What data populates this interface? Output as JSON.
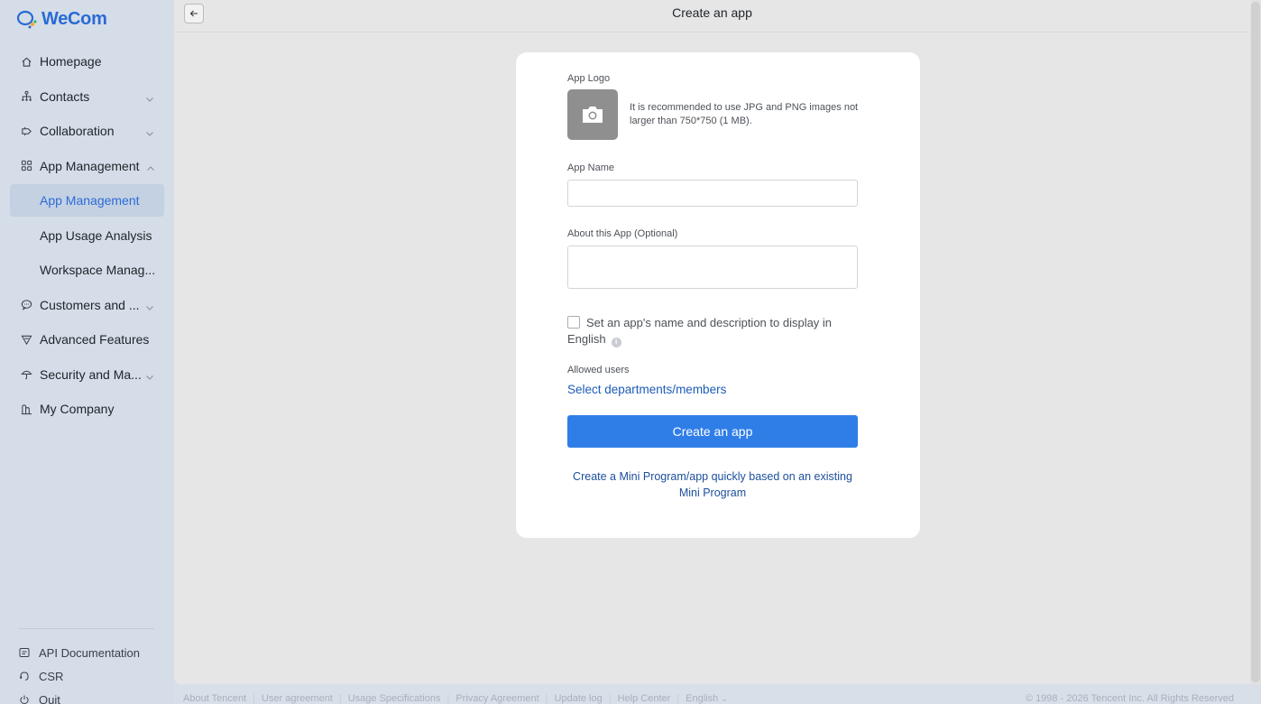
{
  "brand": {
    "name": "WeCom",
    "color": "#2a6ad6"
  },
  "header": {
    "title": "Create an app",
    "back_icon": "arrow-left-icon"
  },
  "sidebar": {
    "items": [
      {
        "label": "Homepage",
        "icon": "home-icon"
      },
      {
        "label": "Contacts",
        "icon": "org-chart-icon",
        "expandable": true
      },
      {
        "label": "Collaboration",
        "icon": "collaboration-icon",
        "expandable": true
      },
      {
        "label": "App Management",
        "icon": "grid-icon",
        "expanded": true
      },
      {
        "label": "Customers and ...",
        "icon": "chat-icon",
        "expandable": true
      },
      {
        "label": "Advanced Features",
        "icon": "filter-icon"
      },
      {
        "label": "Security and Ma...",
        "icon": "umbrella-icon",
        "expandable": true
      },
      {
        "label": "My Company",
        "icon": "building-icon"
      }
    ],
    "sub_items": [
      {
        "label": "App Management",
        "active": true
      },
      {
        "label": "App Usage Analysis"
      },
      {
        "label": "Workspace Manag..."
      }
    ],
    "bottom": [
      {
        "label": "API Documentation",
        "icon": "document-icon"
      },
      {
        "label": "CSR",
        "icon": "headset-icon"
      },
      {
        "label": "Quit",
        "icon": "power-icon"
      }
    ]
  },
  "form": {
    "logo_label": "App Logo",
    "logo_hint": "It is recommended to use JPG and PNG images not larger than 750*750 (1 MB).",
    "name_label": "App Name",
    "name_value": "",
    "about_label": "About this App (Optional)",
    "about_value": "",
    "english_checkbox_label": "Set an app's name and description to display in English",
    "english_checked": false,
    "allowed_users_label": "Allowed users",
    "select_link": "Select departments/members",
    "create_button": "Create an app",
    "mini_program_link": "Create a Mini Program/app quickly based on an existing Mini Program",
    "primary_color": "#2f7ee8"
  },
  "footer": {
    "links": [
      "About Tencent",
      "User agreement",
      "Usage Specifications",
      "Privacy Agreement",
      "Update log",
      "Help Center",
      "English"
    ],
    "copyright": "© 1998 - 2026 Tencent Inc. All Rights Reserved"
  }
}
